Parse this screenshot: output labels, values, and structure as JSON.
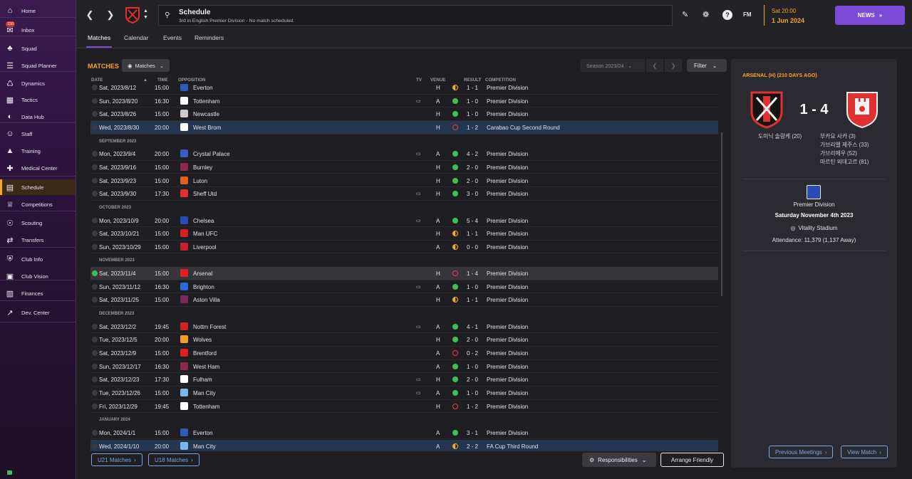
{
  "sidebar": {
    "items": [
      {
        "label": "Home",
        "icon": "home-icon"
      },
      {
        "label": "Inbox",
        "icon": "inbox-icon",
        "badge": "150"
      },
      {
        "label": "Squad",
        "icon": "shirt-icon"
      },
      {
        "label": "Squad Planner",
        "icon": "planner-icon"
      },
      {
        "label": "Dynamics",
        "icon": "dynamics-icon"
      },
      {
        "label": "Tactics",
        "icon": "tactics-icon"
      },
      {
        "label": "Data Hub",
        "icon": "data-hub-icon"
      },
      {
        "label": "Staff",
        "icon": "staff-icon"
      },
      {
        "label": "Training",
        "icon": "training-icon"
      },
      {
        "label": "Medical Center",
        "icon": "medical-icon"
      },
      {
        "label": "Schedule",
        "icon": "calendar-icon"
      },
      {
        "label": "Competitions",
        "icon": "trophy-icon"
      },
      {
        "label": "Scouting",
        "icon": "scouting-icon"
      },
      {
        "label": "Transfers",
        "icon": "transfers-icon"
      },
      {
        "label": "Club Info",
        "icon": "shield-icon"
      },
      {
        "label": "Club Vision",
        "icon": "vision-icon"
      },
      {
        "label": "Finances",
        "icon": "finances-icon"
      },
      {
        "label": "Dev. Center",
        "icon": "dev-center-icon"
      }
    ]
  },
  "header": {
    "title": "Schedule",
    "subtitle": "3rd in English Premier Division - No match scheduled.",
    "date_line1": "Sat 20:00",
    "date_line2": "1 Jun 2024",
    "news_label": "NEWS",
    "fm_label": "FM"
  },
  "subtabs": [
    "Matches",
    "Calendar",
    "Events",
    "Reminders"
  ],
  "matches": {
    "section_title": "MATCHES",
    "view_dropdown": "Matches",
    "season": "Season 2023/24",
    "filter_label": "Filter",
    "columns": {
      "date": "DATE",
      "time": "TIME",
      "opposition": "OPPOSITION",
      "tv": "TV",
      "venue": "VENUE",
      "result": "RESULT",
      "competition": "COMPETITION"
    },
    "rows": [
      {
        "date": "Sat, 2023/8/12",
        "time": "15:00",
        "opp": "Everton",
        "tv": false,
        "venue": "H",
        "res": "d",
        "score": "1 - 1",
        "comp": "Premier Division",
        "crest": "#2a5cb8"
      },
      {
        "date": "Sun, 2023/8/20",
        "time": "16:30",
        "opp": "Tottenham",
        "tv": true,
        "venue": "A",
        "res": "w",
        "score": "1 - 0",
        "comp": "Premier Division",
        "crest": "#ffffff"
      },
      {
        "date": "Sat, 2023/8/26",
        "time": "15:00",
        "opp": "Newcastle",
        "tv": false,
        "venue": "H",
        "res": "w",
        "score": "1 - 0",
        "comp": "Premier Division",
        "crest": "#cccccc"
      },
      {
        "date": "Wed, 2023/8/30",
        "time": "20:00",
        "opp": "West Brom",
        "tv": false,
        "venue": "H",
        "res": "l",
        "score": "1 - 2",
        "comp": "Carabao Cup Second Round",
        "crest": "#ffffff",
        "hl": true
      },
      {
        "month": "SEPTEMBER 2023"
      },
      {
        "date": "Mon, 2023/9/4",
        "time": "20:00",
        "opp": "Crystal Palace",
        "tv": true,
        "venue": "A",
        "res": "w",
        "score": "4 - 2",
        "comp": "Premier Division",
        "crest": "#3a5cc8"
      },
      {
        "date": "Sat, 2023/9/16",
        "time": "15:00",
        "opp": "Burnley",
        "tv": false,
        "venue": "H",
        "res": "w",
        "score": "2 - 0",
        "comp": "Premier Division",
        "crest": "#8a2a4a"
      },
      {
        "date": "Sat, 2023/9/23",
        "time": "15:00",
        "opp": "Luton",
        "tv": false,
        "venue": "H",
        "res": "w",
        "score": "2 - 0",
        "comp": "Premier Division",
        "crest": "#e06020"
      },
      {
        "date": "Sat, 2023/9/30",
        "time": "17:30",
        "opp": "Sheff Utd",
        "tv": true,
        "venue": "H",
        "res": "w",
        "score": "3 - 0",
        "comp": "Premier Division",
        "crest": "#e03030"
      },
      {
        "month": "OCTOBER 2023"
      },
      {
        "date": "Mon, 2023/10/9",
        "time": "20:00",
        "opp": "Chelsea",
        "tv": true,
        "venue": "A",
        "res": "w",
        "score": "5 - 4",
        "comp": "Premier Division",
        "crest": "#2a4cb8"
      },
      {
        "date": "Sat, 2023/10/21",
        "time": "15:00",
        "opp": "Man UFC",
        "tv": false,
        "venue": "H",
        "res": "d",
        "score": "1 - 1",
        "comp": "Premier Division",
        "crest": "#d02020"
      },
      {
        "date": "Sun, 2023/10/29",
        "time": "15:00",
        "opp": "Liverpool",
        "tv": false,
        "venue": "A",
        "res": "d",
        "score": "0 - 0",
        "comp": "Premier Division",
        "crest": "#c81e2e"
      },
      {
        "month": "NOVEMBER 2023"
      },
      {
        "date": "Sat, 2023/11/4",
        "time": "15:00",
        "opp": "Arsenal",
        "tv": false,
        "venue": "H",
        "res": "l",
        "score": "1 - 4",
        "comp": "Premier Division",
        "crest": "#e02020",
        "sel": true,
        "done": true
      },
      {
        "date": "Sun, 2023/11/12",
        "time": "16:30",
        "opp": "Brighton",
        "tv": true,
        "venue": "A",
        "res": "w",
        "score": "1 - 0",
        "comp": "Premier Division",
        "crest": "#2a6cd8"
      },
      {
        "date": "Sat, 2023/11/25",
        "time": "15:00",
        "opp": "Aston Villa",
        "tv": false,
        "venue": "H",
        "res": "d",
        "score": "1 - 1",
        "comp": "Premier Division",
        "crest": "#7a2a5a"
      },
      {
        "month": "DECEMBER 2023"
      },
      {
        "date": "Sat, 2023/12/2",
        "time": "19:45",
        "opp": "Nottm Forest",
        "tv": true,
        "venue": "A",
        "res": "w",
        "score": "4 - 1",
        "comp": "Premier Division",
        "crest": "#d02020"
      },
      {
        "date": "Tue, 2023/12/5",
        "time": "20:00",
        "opp": "Wolves",
        "tv": false,
        "venue": "H",
        "res": "w",
        "score": "2 - 0",
        "comp": "Premier Division",
        "crest": "#f0a020"
      },
      {
        "date": "Sat, 2023/12/9",
        "time": "15:00",
        "opp": "Brentford",
        "tv": false,
        "venue": "A",
        "res": "l",
        "score": "0 - 2",
        "comp": "Premier Division",
        "crest": "#e02020"
      },
      {
        "date": "Sun, 2023/12/17",
        "time": "16:30",
        "opp": "West Ham",
        "tv": false,
        "venue": "A",
        "res": "w",
        "score": "1 - 0",
        "comp": "Premier Division",
        "crest": "#8a2a4a"
      },
      {
        "date": "Sat, 2023/12/23",
        "time": "17:30",
        "opp": "Fulham",
        "tv": true,
        "venue": "H",
        "res": "w",
        "score": "2 - 0",
        "comp": "Premier Division",
        "crest": "#ffffff"
      },
      {
        "date": "Tue, 2023/12/26",
        "time": "15:00",
        "opp": "Man City",
        "tv": true,
        "venue": "A",
        "res": "w",
        "score": "1 - 0",
        "comp": "Premier Division",
        "crest": "#7ab8e8"
      },
      {
        "date": "Fri, 2023/12/29",
        "time": "19:45",
        "opp": "Tottenham",
        "tv": false,
        "venue": "H",
        "res": "l",
        "score": "1 - 2",
        "comp": "Premier Division",
        "crest": "#ffffff"
      },
      {
        "month": "JANUARY 2024"
      },
      {
        "date": "Mon, 2024/1/1",
        "time": "15:00",
        "opp": "Everton",
        "tv": false,
        "venue": "A",
        "res": "w",
        "score": "3 - 1",
        "comp": "Premier Division",
        "crest": "#2a5cb8"
      },
      {
        "date": "Wed, 2024/1/10",
        "time": "20:00",
        "opp": "Man City",
        "tv": false,
        "venue": "A",
        "res": "d",
        "score": "2 - 2",
        "comp": "FA Cup Third Round",
        "crest": "#7ab8e8",
        "hl": true
      }
    ],
    "u21_label": "U21 Matches",
    "u18_label": "U18 Matches",
    "responsibilities_label": "Responsibilities",
    "arrange_friendly_label": "Arrange Friendly"
  },
  "panel": {
    "title": "ARSENAL (H) (210 DAYS AGO)",
    "score": "1 - 4",
    "home_scorers": [
      "도미닉 솔랑케 (20)"
    ],
    "away_scorers": [
      "부카요 사카 (3)",
      "가브리엘 제주스 (33)",
      "가브리에우 (52)",
      "마르틴 외데고르 (81)"
    ],
    "competition": "Premier Division",
    "date": "Saturday November 4th 2023",
    "stadium": "Vitality Stadium",
    "attendance": "Attendance: 11,379 (1,137 Away)",
    "prev_meetings_label": "Previous Meetings",
    "view_match_label": "View Match"
  }
}
